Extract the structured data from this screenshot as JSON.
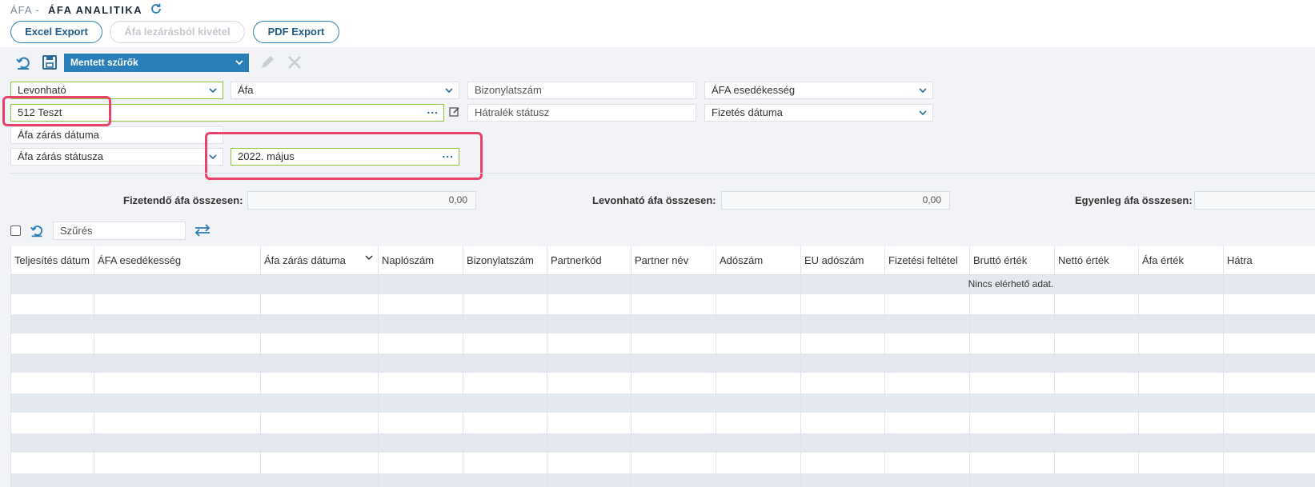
{
  "header": {
    "crumb": "ÁFA -",
    "title": "ÁFA ANALITIKA",
    "refresh_icon": "refresh-icon"
  },
  "toolbar": {
    "excel_label": "Excel Export",
    "remove_label": "Áfa lezárásból kivétel",
    "pdf_label": "PDF Export"
  },
  "saved_filters": {
    "label": "Mentett szűrők",
    "icons": [
      "undo-icon",
      "save-icon",
      "pencil-icon",
      "close-icon"
    ]
  },
  "filters": {
    "levonhato": "Levonható",
    "afa": "Áfa",
    "bizonylatszam": "Bizonylatszám",
    "afa_esedekesseg": "ÁFA esedékesség",
    "partner": "512 Teszt",
    "hatralek": "Hátralék státusz",
    "fizetes_datuma": "Fizetés dátuma",
    "zaras_datuma": "Áfa zárás dátuma",
    "zaras_statusza": "Áfa zárás státusza",
    "period": "2022. május",
    "dots": "..."
  },
  "totals": {
    "fizetendo_label": "Fizetendő áfa összesen:",
    "fizetendo_value": "0,00",
    "levonhato_label": "Levonható áfa összesen:",
    "levonhato_value": "0,00",
    "egyenleg_label": "Egyenleg áfa összesen:"
  },
  "grid_toolbar": {
    "search_placeholder": "Szűrés"
  },
  "grid": {
    "columns": [
      "Teljesítés dátum",
      "ÁFA esedékesség",
      "Áfa zárás dátuma",
      "Naplószám",
      "Bizonylatszám",
      "Partnerkód",
      "Partner név",
      "Adószám",
      "EU adószám",
      "Fizetési feltétel",
      "Bruttó érték",
      "Nettó érték",
      "Áfa érték",
      "Hátra"
    ],
    "empty_message": "Nincs elérhető adat."
  },
  "colors": {
    "accent": "#2b7fb8",
    "highlight": "#e8426b",
    "field_valid": "#8cc63f"
  }
}
